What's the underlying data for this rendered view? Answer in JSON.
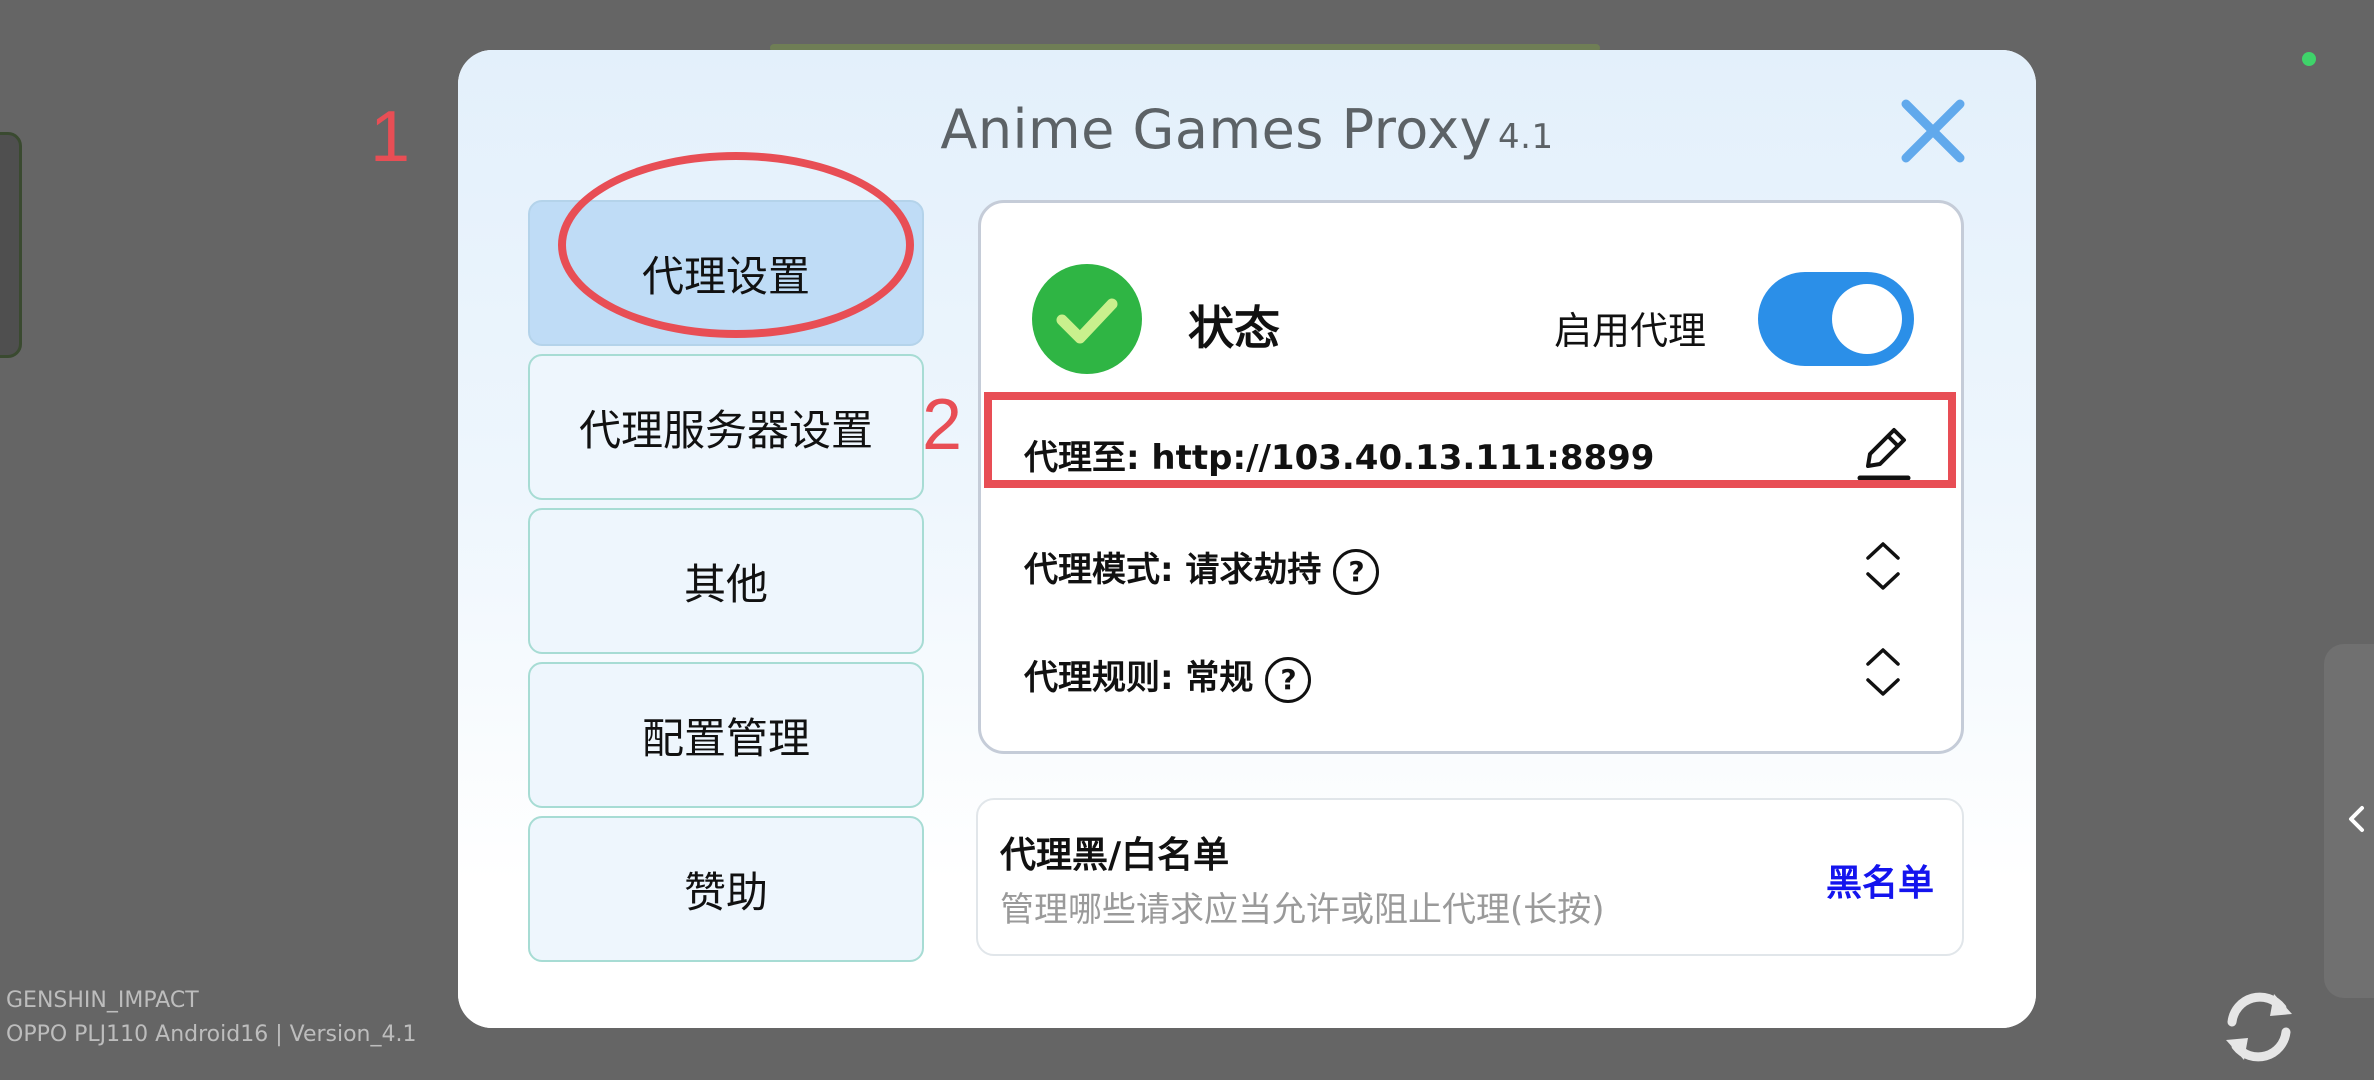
{
  "dialog": {
    "title": "Anime Games Proxy",
    "version": "4.1"
  },
  "annotations": {
    "one": "1",
    "two": "2"
  },
  "nav": {
    "items": [
      {
        "label": "代理设置"
      },
      {
        "label": "代理服务器设置"
      },
      {
        "label": "其他"
      },
      {
        "label": "配置管理"
      },
      {
        "label": "赞助"
      }
    ]
  },
  "status": {
    "label": "状态",
    "enable_label": "启用代理",
    "enabled": true
  },
  "rows": {
    "proxy_to": "代理至: http://103.40.13.111:8899",
    "proxy_mode": "代理模式: 请求劫持",
    "proxy_rule": "代理规则: 常规",
    "help_glyph": "?"
  },
  "list": {
    "title": "代理黑/白名单",
    "description": "管理哪些请求应当允许或阻止代理(长按)",
    "mode": "黑名单"
  },
  "footer": {
    "game": "GENSHIN_IMPACT",
    "device": "OPPO PLJ110 Android16 | Version_4.1"
  },
  "colors": {
    "accent": "#2b8fe8",
    "status_ok": "#2fb544",
    "annotation": "#e84e55",
    "link": "#1414ee"
  }
}
